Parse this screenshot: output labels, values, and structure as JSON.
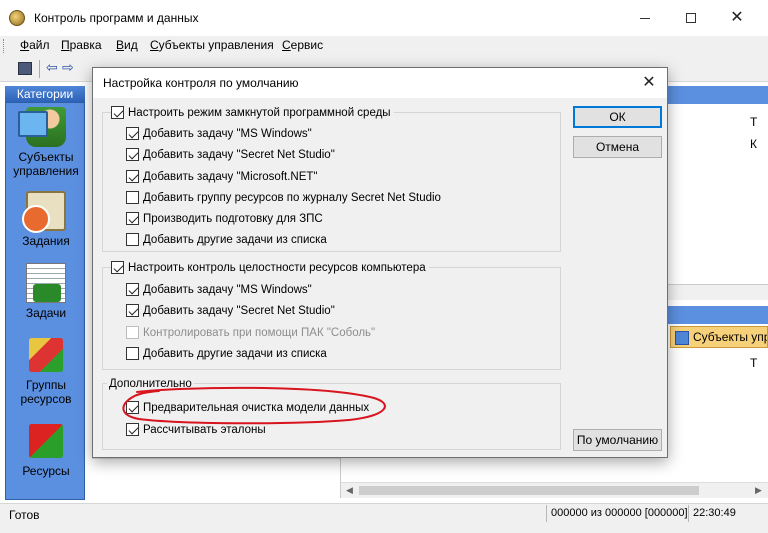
{
  "window": {
    "title": "Контроль программ и данных"
  },
  "menu": [
    "Файл",
    "Правка",
    "Вид",
    "Субъекты управления",
    "Сервис"
  ],
  "categories": {
    "header": "Категории",
    "items": [
      {
        "label_line1": "Субъекты",
        "label_line2": "управления",
        "icon": "users-icon"
      },
      {
        "label_line1": "Задания",
        "label_line2": "",
        "icon": "tasks-icon"
      },
      {
        "label_line1": "Задачи",
        "label_line2": "",
        "icon": "jobs-icon"
      },
      {
        "label_line1": "Группы",
        "label_line2": "ресурсов",
        "icon": "resource-groups-icon"
      },
      {
        "label_line1": "Ресурсы",
        "label_line2": "",
        "icon": "resources-icon"
      }
    ]
  },
  "background": {
    "col_t1": "Т",
    "col_k": "К",
    "col_t2": "Т",
    "tab_label": "Субъекты упр"
  },
  "dialog": {
    "title": "Настройка контроля по умолчанию",
    "group1": {
      "title": "Настроить режим замкнутой программной среды",
      "title_checked": true,
      "items": [
        {
          "label": "Добавить задачу \"MS Windows\"",
          "checked": true,
          "disabled": false
        },
        {
          "label": "Добавить задачу \"Secret Net Studio\"",
          "checked": true,
          "disabled": false
        },
        {
          "label": "Добавить задачу \"Microsoft.NET\"",
          "checked": true,
          "disabled": false
        },
        {
          "label": "Добавить группу ресурсов по журналу Secret Net Studio",
          "checked": false,
          "disabled": false
        },
        {
          "label": "Производить подготовку для ЗПС",
          "checked": true,
          "disabled": false
        },
        {
          "label": "Добавить другие задачи из списка",
          "checked": false,
          "disabled": false
        }
      ]
    },
    "group2": {
      "title": "Настроить контроль целостности ресурсов компьютера",
      "title_checked": true,
      "items": [
        {
          "label": "Добавить задачу \"MS Windows\"",
          "checked": true,
          "disabled": false
        },
        {
          "label": "Добавить задачу \"Secret Net Studio\"",
          "checked": true,
          "disabled": false
        },
        {
          "label": "Контролировать при помощи ПАК \"Соболь\"",
          "checked": false,
          "disabled": true
        },
        {
          "label": "Добавить другие задачи из списка",
          "checked": false,
          "disabled": false
        }
      ]
    },
    "group3": {
      "title": "Дополнительно",
      "items": [
        {
          "label": "Предварительная очистка модели данных",
          "checked": true,
          "disabled": false
        },
        {
          "label": "Рассчитывать эталоны",
          "checked": true,
          "disabled": false
        }
      ]
    },
    "buttons": {
      "ok": "ОК",
      "cancel": "Отмена",
      "defaults": "По умолчанию"
    },
    "annotation_color": "#d8141e"
  },
  "status": {
    "left": "Готов",
    "count": "000000 из 000000 [000000]",
    "time": "22:30:49"
  }
}
